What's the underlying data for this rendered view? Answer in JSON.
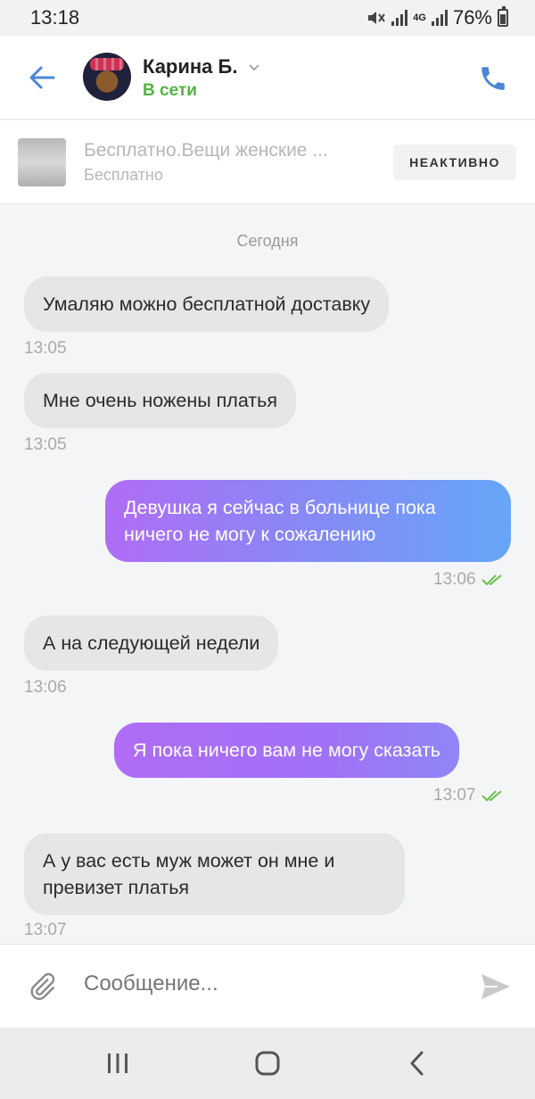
{
  "status": {
    "time": "13:18",
    "battery": "76%",
    "network": "4G"
  },
  "header": {
    "name": "Карина Б.",
    "status": "В сети"
  },
  "ad": {
    "title": "Бесплатно.Вещи женские ...",
    "price": "Бесплатно",
    "badge": "НЕАКТИВНО"
  },
  "chat": {
    "date": "Сегодня",
    "messages": [
      {
        "dir": "in",
        "text": "Умаляю можно бесплатной доставку",
        "time": "13:05"
      },
      {
        "dir": "in",
        "text": "Мне очень ножены платья",
        "time": "13:05"
      },
      {
        "dir": "out",
        "text": "Девушка я сейчас в больнице пока ничего не могу к сожалению",
        "time": "13:06"
      },
      {
        "dir": "in",
        "text": "А на следующей недели",
        "time": "13:06"
      },
      {
        "dir": "out",
        "text": "Я пока ничего вам не могу сказать",
        "time": "13:07"
      },
      {
        "dir": "in",
        "text": "А у вас есть муж может он мне и превизет платья",
        "time": "13:07"
      }
    ]
  },
  "composer": {
    "placeholder": "Сообщение..."
  },
  "colors": {
    "accent": "#4b86d6",
    "online": "#53b342",
    "out_start": "#b06cf5",
    "out_end": "#66a6f8",
    "incoming": "#e6e6e8"
  },
  "icons": {
    "back": "arrow-left-icon",
    "phone": "phone-icon",
    "attach": "paperclip-icon",
    "send": "send-icon",
    "read": "double-check-icon"
  }
}
